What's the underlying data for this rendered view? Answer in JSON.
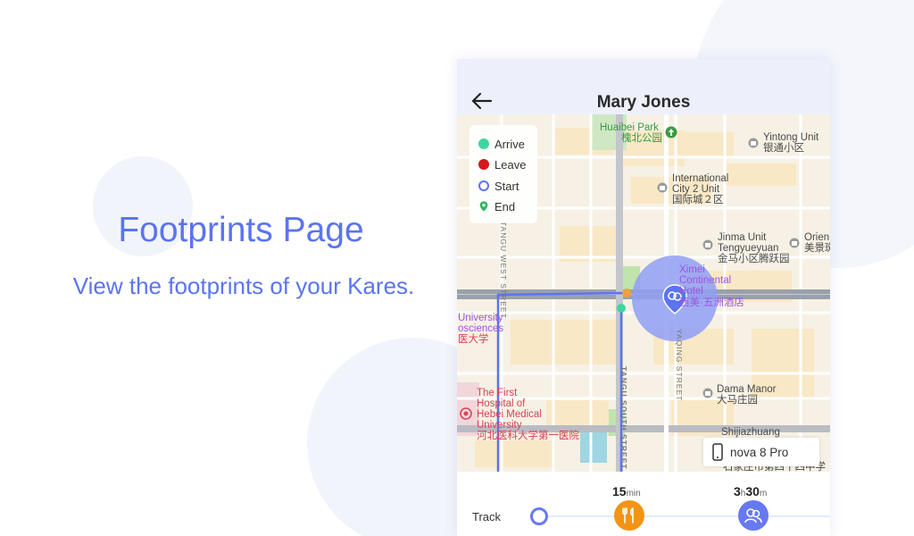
{
  "promo": {
    "title": "Footprints Page",
    "subtitle": "View the footprints of your Kares."
  },
  "header": {
    "title": "Mary Jones",
    "back_icon": "arrow-left-icon"
  },
  "legend": {
    "items": [
      {
        "label": "Arrive",
        "marker": "filled-dot",
        "color": "#3ed6a0"
      },
      {
        "label": "Leave",
        "marker": "filled-dot",
        "color": "#d51919"
      },
      {
        "label": "Start",
        "marker": "ring",
        "color": "#5b74f0"
      },
      {
        "label": "End",
        "marker": "pin",
        "color": "#2fb35c"
      }
    ]
  },
  "map": {
    "pois": {
      "huaibei_en": "Huaibei Park",
      "huaibei_cn": "槐北公园",
      "yintong_en": "Yintong Unit",
      "yintong_cn": "银通小区",
      "intl_en1": "International",
      "intl_en2": "City 2 Unit",
      "intl_cn": "国际城２区",
      "jinma_en1": "Jinma Unit",
      "jinma_en2": "Tengyueyuan",
      "jinma_cn": "金马小区腾跃园",
      "orien_en": "Orien",
      "orien_cn": "美景斑",
      "ximei_en1": "Ximei",
      "ximei_en2": "Continental",
      "ximei_en3": "Hotel",
      "ximei_cn": "西美·五洲酒店",
      "univ_en1": "University",
      "univ_en2": "osciences",
      "univ_cn": "医大学",
      "hosp_en1": "The First",
      "hosp_en2": "Hospital of",
      "hosp_en3": "Hebei Medical",
      "hosp_en4": "University",
      "hosp_cn": "河北医科大学第一医院",
      "dama_en": "Dama Manor",
      "dama_cn": "大马庄园",
      "shijia_en": "Shijiazhuang",
      "shijia_cn": "石家庄市第四十四中学"
    },
    "streets": {
      "tangu_west": "TANGU WEST STREET",
      "tangu_south": "TANGU SOUTH STREET",
      "yaqing": "YAQING STREET"
    },
    "route_color": "#5b74f0",
    "radius_color": "#8f9ff5"
  },
  "device": {
    "name": "nova 8 Pro",
    "icon": "phone-icon"
  },
  "track": {
    "label": "Track",
    "stops": [
      {
        "type": "start",
        "icon": "ring-icon"
      },
      {
        "type": "food",
        "icon": "utensils-icon",
        "duration": {
          "v1": "15",
          "u1": "min"
        }
      },
      {
        "type": "kare",
        "icon": "kare-icon",
        "duration": {
          "v1": "3",
          "u1": "h",
          "v2": "30",
          "u2": "m"
        }
      }
    ]
  },
  "colors": {
    "accent": "#5b74f0",
    "food": "#f39415",
    "arrive": "#3ed6a0",
    "leave": "#d51919"
  }
}
